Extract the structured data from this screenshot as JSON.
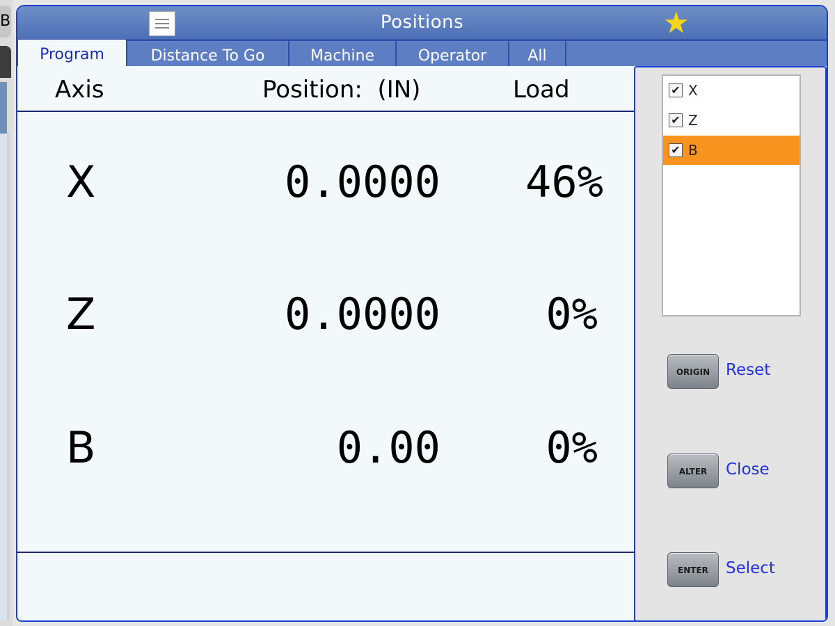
{
  "left_panel": {
    "tab_letter": "B"
  },
  "window": {
    "title": "Positions",
    "tabs": [
      "Program",
      "Distance To Go",
      "Machine",
      "Operator",
      "All"
    ],
    "active_tab": "Program"
  },
  "table": {
    "header": {
      "axis": "Axis",
      "position": "Position:  (IN)",
      "load": "Load"
    },
    "rows": [
      {
        "axis": "X",
        "position": "0.0000",
        "load": "46%"
      },
      {
        "axis": "Z",
        "position": "0.0000",
        "load": "0%"
      },
      {
        "axis": "B",
        "position": "0.00",
        "load": "0%"
      }
    ]
  },
  "axis_list": {
    "items": [
      {
        "label": "X",
        "checked": true
      },
      {
        "label": "Z",
        "checked": true
      },
      {
        "label": "B",
        "checked": true
      }
    ],
    "selected": "B",
    "check_mark": "✔"
  },
  "keys": [
    {
      "key": "ORIGIN",
      "action": "Reset"
    },
    {
      "key": "ALTER",
      "action": "Close"
    },
    {
      "key": "ENTER",
      "action": "Select"
    }
  ],
  "colors": {
    "accent": "#4d6fb6",
    "selection": "#f7931e",
    "link": "#2230e0",
    "star": "#f6d51f"
  }
}
